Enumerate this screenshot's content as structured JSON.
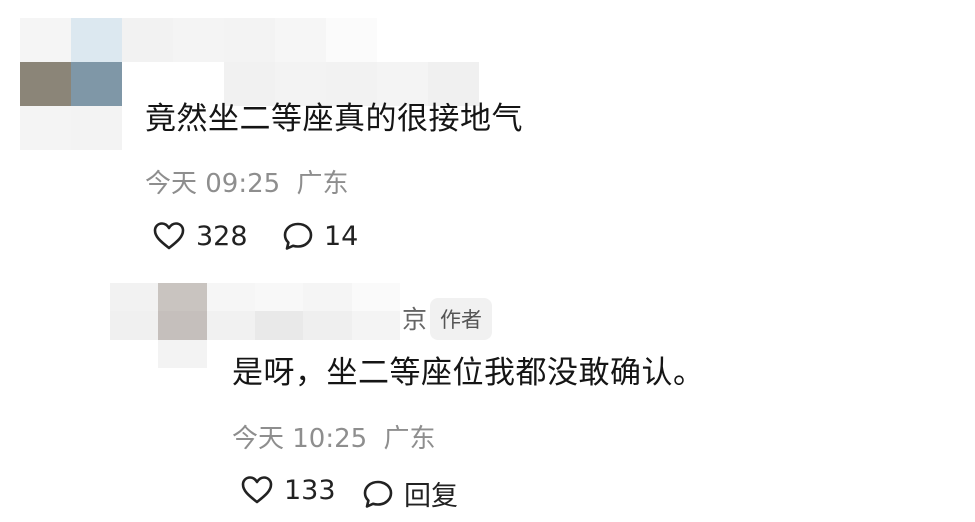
{
  "comments": [
    {
      "text": "竟然坐二等座真的很接地气",
      "time": "今天 09:25",
      "location": "广东",
      "likes": "328",
      "replies": "14",
      "icons": {
        "like": "heart-outline-icon",
        "reply": "comment-bubble-icon"
      }
    },
    {
      "name_tail": "京",
      "badge": "作者",
      "text": "是呀，坐二等座位我都没敢确认。",
      "time": "今天 10:25",
      "location": "广东",
      "likes": "133",
      "reply_label": "回复",
      "icons": {
        "like": "heart-outline-icon",
        "reply": "comment-bubble-icon"
      }
    }
  ]
}
